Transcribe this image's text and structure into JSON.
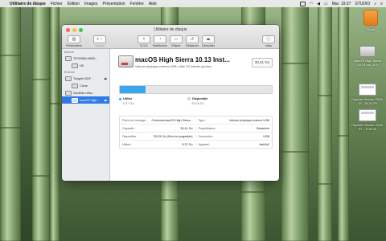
{
  "menubar": {
    "app_name": "Utilitaire de disque",
    "menus": [
      "Fichier",
      "Édition",
      "Images",
      "Présentation",
      "Fenêtre",
      "Aide"
    ],
    "clock": "Mar. 19:37",
    "user": "STUDIO"
  },
  "desktop": {
    "icons": [
      {
        "label": "Clone"
      },
      {
        "label": "macOS High Sierra 10.13 Ins...6.0"
      },
      {
        "label": "Capture d'écran 2018-07...18.22.25"
      },
      {
        "label": "Capture d'écran 2018-07...-9.36.44"
      }
    ]
  },
  "window": {
    "title": "Utilitaire de disque",
    "toolbar": {
      "left": [
        {
          "label": "Présentation",
          "icon": "sidebar-icon"
        },
        {
          "label": "Volume",
          "icon": "plus-minus-icon"
        }
      ],
      "center": [
        {
          "label": "S.O.S.",
          "icon": "stethoscope-icon"
        },
        {
          "label": "Partitionner",
          "icon": "pie-icon"
        },
        {
          "label": "Effacer",
          "icon": "eraser-icon"
        },
        {
          "label": "Restaurer",
          "icon": "restore-icon"
        },
        {
          "label": "Démonter",
          "icon": "eject-icon"
        }
      ],
      "right": [
        {
          "label": "Infos",
          "icon": "info-icon"
        }
      ]
    },
    "sidebar": {
      "sections": [
        {
          "heading": "Interne",
          "items": [
            {
              "label": "TOSHIBA MK50...",
              "level": 0,
              "selected": false,
              "eject": false
            },
            {
              "label": "HD",
              "level": 1,
              "selected": false,
              "eject": false
            }
          ]
        },
        {
          "heading": "Externe",
          "items": [
            {
              "label": "Toogale BUF...",
              "level": 0,
              "selected": false,
              "eject": true
            },
            {
              "label": "Clone",
              "level": 1,
              "selected": false,
              "eject": false
            },
            {
              "label": "SanDisk Ultra...",
              "level": 0,
              "selected": false,
              "eject": false
            },
            {
              "label": "macOS High...",
              "level": 1,
              "selected": true,
              "eject": true
            }
          ]
        }
      ]
    },
    "volume": {
      "name": "macOS High Sierra 10.13 Inst...",
      "subtitle": "Volume physique externe USB • Mac OS étendu (journa...",
      "size": "30,41 Go",
      "usage": {
        "used_fraction": 0.17,
        "used_label": "Utilisé",
        "used_value": "5,37 Go",
        "used_color": "#38a7ef",
        "free_label": "Disponible",
        "free_value": "25,03 Go",
        "free_color": "#f6f6f6"
      },
      "info": [
        {
          "lk": "Point de montage :",
          "lv": "/Volumes/macOS High Sierra...",
          "rk": "Type :",
          "rv": "Volume physique externe USB"
        },
        {
          "lk": "Capacité :",
          "lv": "30,41 Go",
          "rk": "Propriétaires :",
          "rv": "Désactivé"
        },
        {
          "lk": "Disponible :",
          "lv": "25,03 Go (Zéro ko purgeable)",
          "rk": "Connexion :",
          "rv": "USB"
        },
        {
          "lk": "Utilisé :",
          "lv": "5,37 Go",
          "rk": "Appareil :",
          "rv": "disk3s2"
        }
      ]
    }
  },
  "colors": {
    "selection": "#2f7ae5",
    "close": "#fc605c",
    "minimize": "#fdbc40",
    "zoom": "#34c84a"
  }
}
